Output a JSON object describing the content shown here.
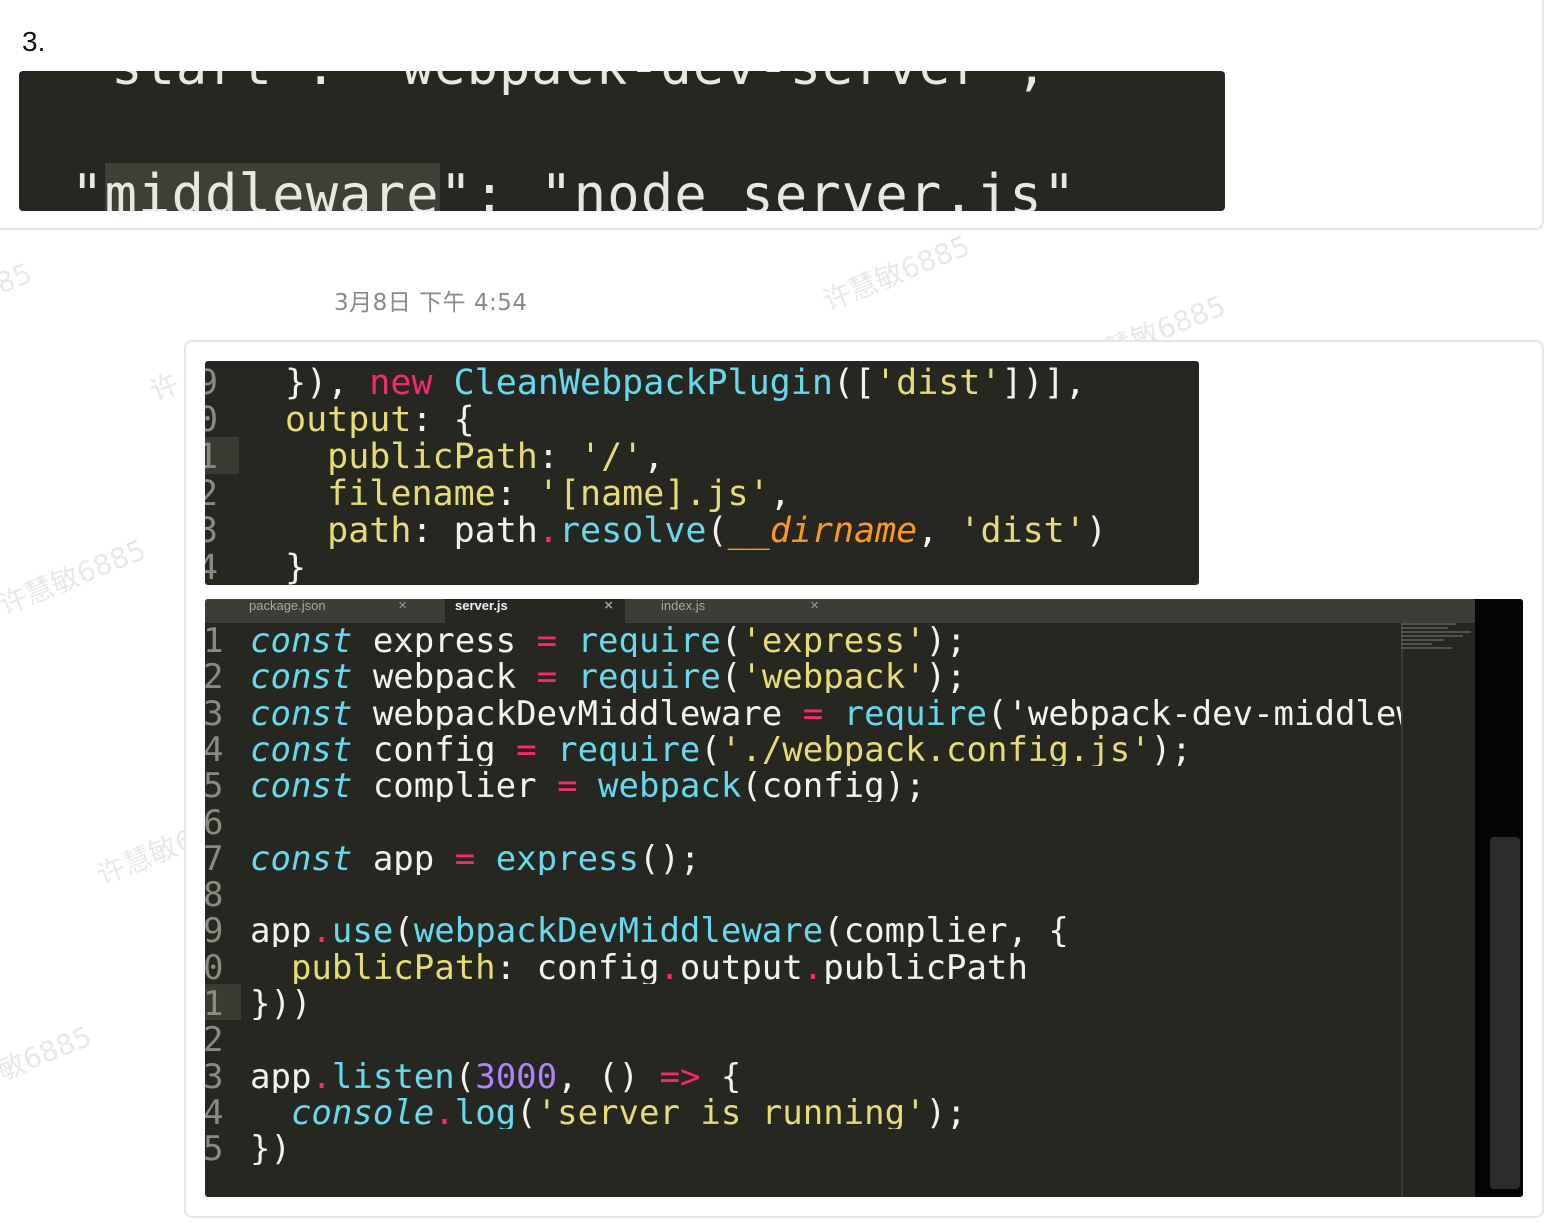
{
  "item_number": "3.",
  "timestamp": "3月8日 下午 4:54",
  "watermarks": [
    "85",
    "许慧敏6885",
    "许慧敏6885",
    "许",
    "许慧敏6885",
    "许慧敏6",
    "敏6885"
  ],
  "snippet1": {
    "top_cut_line": "\"start\": \"webpack-dev-server\",",
    "line": "\"middleware\": \"node server.js\"",
    "trailing": ","
  },
  "snippet2": {
    "lines": [
      {
        "gutter": "9",
        "text": "}), new CleanWebpackPlugin(['dist'])],"
      },
      {
        "gutter": "0",
        "text": "output: {"
      },
      {
        "gutter": "1",
        "text": "  publicPath: '/',"
      },
      {
        "gutter": "2",
        "text": "  filename: '[name].js',"
      },
      {
        "gutter": "3",
        "text": "  path: path.resolve(__dirname, 'dist')"
      },
      {
        "gutter": "4",
        "text": "}"
      }
    ]
  },
  "editor": {
    "tabs": [
      {
        "name": "package.json",
        "close": "×",
        "active": false
      },
      {
        "name": "server.js",
        "close": "×",
        "active": true
      },
      {
        "name": "index.js",
        "close": "×",
        "active": false
      }
    ],
    "lines": [
      {
        "gutter": "1",
        "text": "const express = require('express');"
      },
      {
        "gutter": "2",
        "text": "const webpack = require('webpack');"
      },
      {
        "gutter": "3",
        "text": "const webpackDevMiddleware = require('webpack-dev-middlewar"
      },
      {
        "gutter": "4",
        "text": "const config = require('./webpack.config.js');"
      },
      {
        "gutter": "5",
        "text": "const complier = webpack(config);"
      },
      {
        "gutter": "6",
        "text": ""
      },
      {
        "gutter": "7",
        "text": "const app = express();"
      },
      {
        "gutter": "8",
        "text": ""
      },
      {
        "gutter": "9",
        "text": "app.use(webpackDevMiddleware(complier, {"
      },
      {
        "gutter": "0",
        "text": "  publicPath: config.output.publicPath"
      },
      {
        "gutter": "1",
        "text": "}))"
      },
      {
        "gutter": "2",
        "text": ""
      },
      {
        "gutter": "3",
        "text": "app.listen(3000, () => {"
      },
      {
        "gutter": "4",
        "text": "  console.log('server is running');"
      },
      {
        "gutter": "5",
        "text": "})"
      }
    ]
  },
  "colors": {
    "editor_bg": "#262721",
    "keyword": "#66d9ef",
    "string": "#e6db74",
    "operator": "#f92672",
    "number": "#ae81ff"
  }
}
